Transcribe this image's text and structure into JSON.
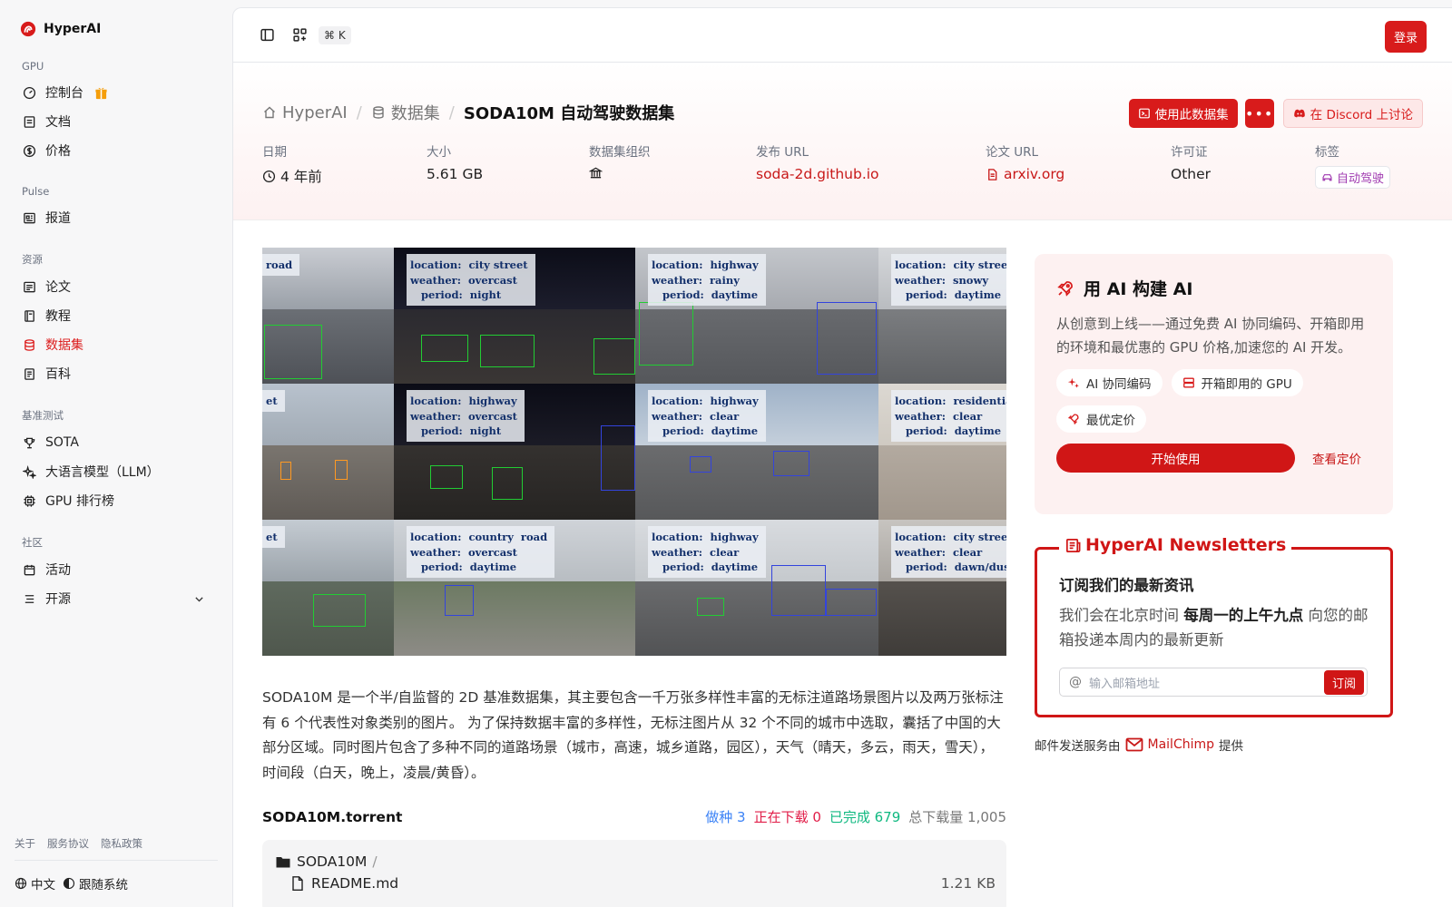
{
  "brand": {
    "name": "HyperAI"
  },
  "sidebar": {
    "sections": [
      {
        "label": "GPU",
        "items": [
          {
            "label": "控制台",
            "icon": "gauge-icon"
          },
          {
            "label": "文档",
            "icon": "book-icon"
          },
          {
            "label": "价格",
            "icon": "dollar-icon"
          }
        ]
      },
      {
        "label": "Pulse",
        "items": [
          {
            "label": "报道",
            "icon": "newspaper-icon"
          }
        ]
      },
      {
        "label": "资源",
        "items": [
          {
            "label": "论文",
            "icon": "paper-icon"
          },
          {
            "label": "教程",
            "icon": "notebook-icon"
          },
          {
            "label": "数据集",
            "icon": "database-icon"
          },
          {
            "label": "百科",
            "icon": "wiki-icon"
          }
        ]
      },
      {
        "label": "基准测试",
        "items": [
          {
            "label": "SOTA",
            "icon": "trophy-icon"
          },
          {
            "label": "大语言模型（LLM）",
            "icon": "sparkles-icon"
          },
          {
            "label": "GPU 排行榜",
            "icon": "cpu-icon"
          }
        ]
      },
      {
        "label": "社区",
        "items": [
          {
            "label": "活动",
            "icon": "calendar-icon"
          },
          {
            "label": "开源",
            "icon": "list-icon"
          }
        ]
      }
    ],
    "footer_links": [
      "关于",
      "服务协议",
      "隐私政策"
    ],
    "language": "中文",
    "theme": "跟随系统"
  },
  "topbar": {
    "shortcut": "⌘ K",
    "login": "登录"
  },
  "breadcrumb": {
    "home": "HyperAI",
    "section": "数据集",
    "current": "SODA10M 自动驾驶数据集"
  },
  "actions": {
    "use_dataset": "使用此数据集",
    "more": "•••",
    "discord": "在 Discord 上讨论"
  },
  "meta": {
    "date_label": "日期",
    "date_value": "4 年前",
    "size_label": "大小",
    "size_value": "5.61 GB",
    "org_label": "数据集组织",
    "release_label": "发布 URL",
    "release_value": "soda-2d.github.io",
    "paper_label": "论文 URL",
    "paper_value": "arxiv.org",
    "license_label": "许可证",
    "license_value": "Other",
    "tags_label": "标签",
    "tag_value": "自动驾驶"
  },
  "hero_labels": [
    "road",
    "location:  city street\nweather:  overcast\n   period:  night",
    "location:  highway\nweather:  rainy\n   period:  daytime",
    "location:  city street\nweather:  snowy\n   period:  daytime",
    "et",
    "location:  highway\nweather:  overcast\n   period:  night",
    "location:  highway\nweather:  clear\n   period:  daytime",
    "location:  residential\nweather:  clear\n   period:  daytime",
    "et",
    "location:  country  road\nweather:  overcast\n   period:  daytime",
    "location:  highway\nweather:  clear\n   period:  daytime",
    "location:  city street\nweather:  clear\n   period:  dawn/dusk"
  ],
  "description": "SODA10M 是一个半/自监督的 2D 基准数据集，其主要包含一千万张多样性丰富的无标注道路场景图片以及两万张标注有 6 个代表性对象类别的图片。 为了保持数据丰富的多样性，无标注图片从 32 个不同的城市中选取，囊括了中国的大部分区域。同时图片包含了多种不同的道路场景（城市，高速，城乡道路，园区），天气（晴天，多云，雨天，雪天），时间段（白天，晚上，凌晨/黄昏）。",
  "torrent": {
    "name": "SODA10M.torrent",
    "seeding": "做种 3",
    "downloading": "正在下载 0",
    "completed": "已完成 679",
    "total": "总下载量 1,005",
    "folder": "SODA10M",
    "files": [
      {
        "name": "README.md",
        "size": "1.21 KB"
      }
    ]
  },
  "ai_card": {
    "title": "用 AI 构建 AI",
    "desc": "从创意到上线——通过免费 AI 协同编码、开箱即用的环境和最优惠的 GPU 价格,加速您的 AI 开发。",
    "chips": [
      "AI 协同编码",
      "开箱即用的 GPU",
      "最优定价"
    ],
    "start": "开始使用",
    "pricing": "查看定价"
  },
  "newsletter": {
    "legend": "HyperAI Newsletters",
    "heading": "订阅我们的最新资讯",
    "p_before": "我们会在北京时间 ",
    "p_bold": "每周一的上午九点",
    "p_after": " 向您的邮箱投递本周内的最新更新",
    "placeholder": "输入邮箱地址",
    "button": "订阅",
    "provider_prefix": "邮件发送服务由",
    "provider_name": "MailChimp",
    "provider_suffix": "提供"
  },
  "colors": {
    "accent": "#d81b1b"
  }
}
